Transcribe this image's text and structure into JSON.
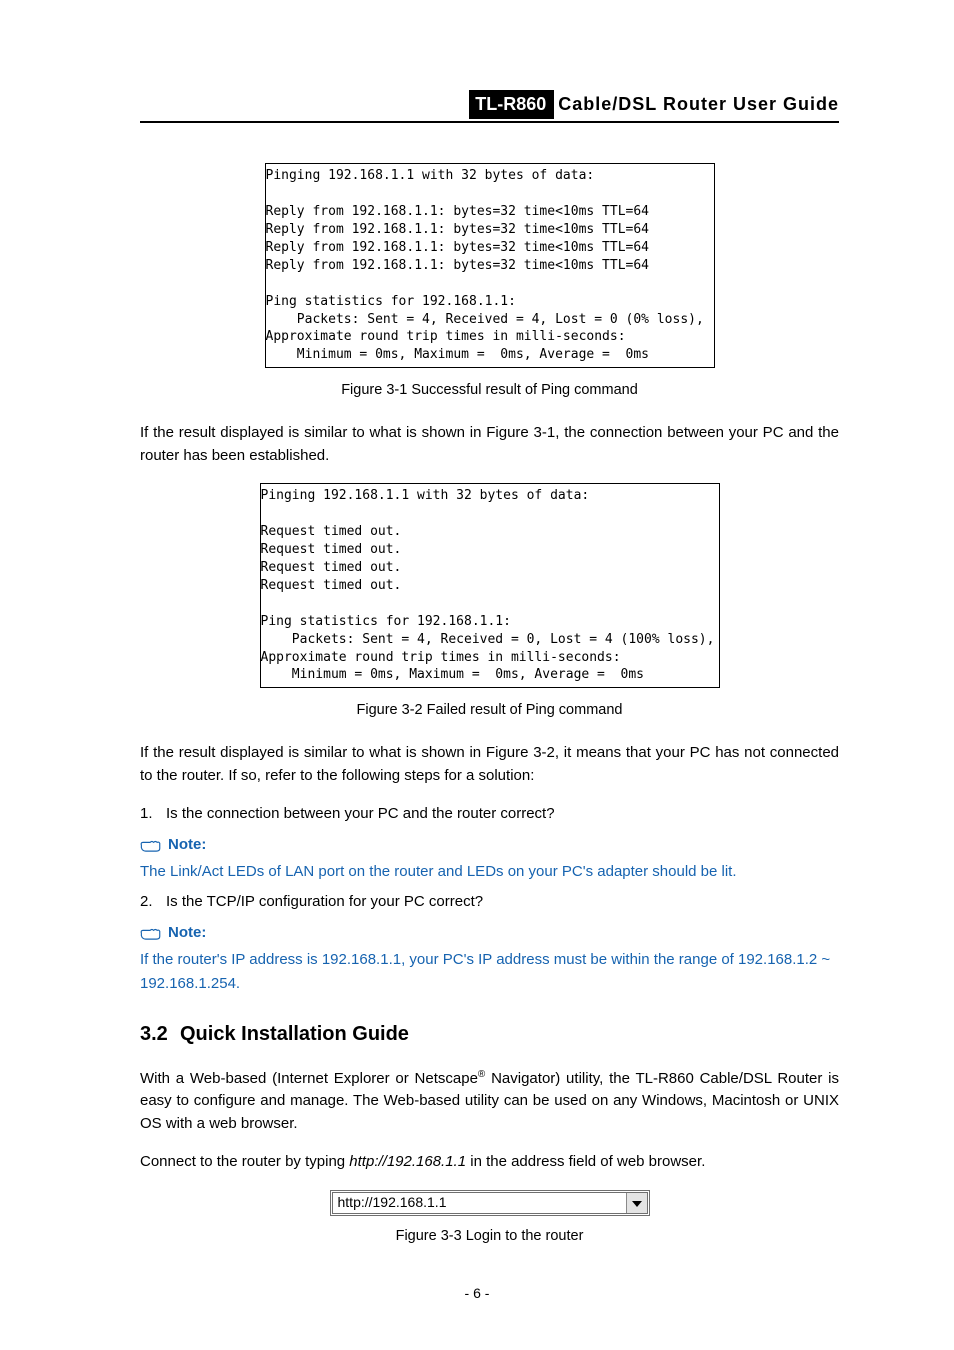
{
  "header": {
    "model": "TL-R860",
    "title": "Cable/DSL  Router  User  Guide"
  },
  "cmd1": "Pinging 192.168.1.1 with 32 bytes of data:\n\nReply from 192.168.1.1: bytes=32 time<10ms TTL=64\nReply from 192.168.1.1: bytes=32 time<10ms TTL=64\nReply from 192.168.1.1: bytes=32 time<10ms TTL=64\nReply from 192.168.1.1: bytes=32 time<10ms TTL=64\n\nPing statistics for 192.168.1.1:\n    Packets: Sent = 4, Received = 4, Lost = 0 (0% loss),\nApproximate round trip times in milli-seconds:\n    Minimum = 0ms, Maximum =  0ms, Average =  0ms",
  "fig1": "Figure 3-1    Successful result of Ping command",
  "para1": "If the result displayed is similar to what is shown in Figure 3-1, the connection between your PC and the router has been established.",
  "cmd2": "Pinging 192.168.1.1 with 32 bytes of data:\n\nRequest timed out.\nRequest timed out.\nRequest timed out.\nRequest timed out.\n\nPing statistics for 192.168.1.1:\n    Packets: Sent = 4, Received = 0, Lost = 4 (100% loss),\nApproximate round trip times in milli-seconds:\n    Minimum = 0ms, Maximum =  0ms, Average =  0ms",
  "fig2": "Figure 3-2    Failed result of Ping command",
  "para2": "If the result displayed is similar to what is shown in Figure 3-2, it means that your PC has not connected to the router. If so, refer to the following steps for a solution:",
  "step1_num": "1.",
  "step1_text": "Is the connection between your PC and the router correct?",
  "note_label": "Note:",
  "note1_text": "The Link/Act LEDs of LAN port on the router and LEDs on your PC's adapter should be lit.",
  "step2_num": "2.",
  "step2_text": "Is the TCP/IP configuration for your PC correct?",
  "note2_text": "If the router's IP address is 192.168.1.1, your PC's IP address must be within the range of 192.168.1.2 ~ 192.168.1.254.",
  "section": {
    "num": "3.2",
    "title": "Quick Installation Guide"
  },
  "para3_a": "With a Web-based (Internet Explorer or Netscape",
  "para3_b": " Navigator) utility, the TL-R860 Cable/DSL Router is easy to configure and manage. The Web-based utility can be used on any Windows, Macintosh or UNIX OS with a web browser.",
  "para4_a": "Connect to the router by typing ",
  "para4_url": "http://192.168.1.1",
  "para4_b": " in the address field of web browser.",
  "urlbox": "http://192.168.1.1",
  "fig3": "Figure 3-3 Login to the router",
  "footer": "- 6 -"
}
